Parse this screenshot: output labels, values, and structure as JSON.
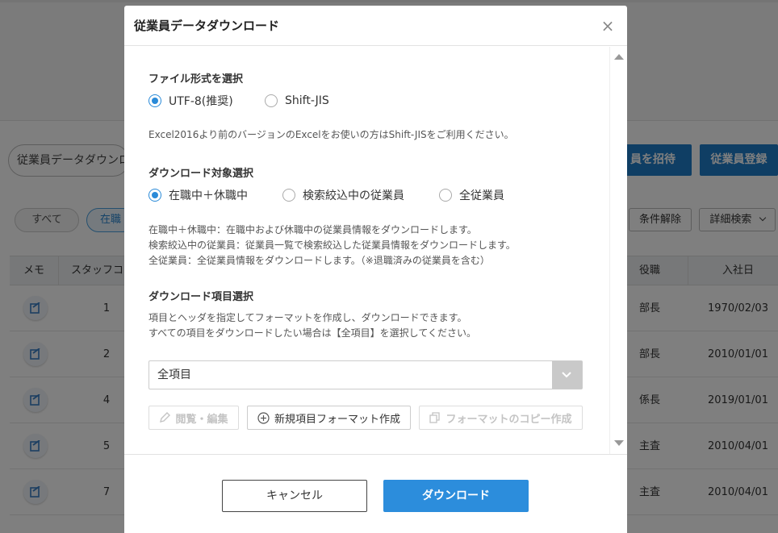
{
  "background": {
    "search_text": "従業員データダウンロ",
    "invite_button": "員を招待",
    "register_button": "従業員登録",
    "filter_all": "すべて",
    "filter_active": "在職",
    "clear_conditions": "条件解除",
    "advanced_search": "詳細検索",
    "table": {
      "headers": {
        "memo": "メモ",
        "staff_code": "スタッフコー",
        "position": "役職",
        "hire_date": "入社日"
      },
      "rows": [
        {
          "code": "1",
          "position": "部長",
          "hire_date": "1970/02/03"
        },
        {
          "code": "2",
          "position": "部長",
          "hire_date": "2010/01/01"
        },
        {
          "code": "4",
          "position": "係長",
          "hire_date": "2019/01/01"
        },
        {
          "code": "5",
          "position": "主査",
          "hire_date": "2010/04/01"
        },
        {
          "code": "7",
          "position": "主査",
          "hire_date": "2010/04/01"
        }
      ]
    }
  },
  "modal": {
    "title": "従業員データダウンロード",
    "close_label": "×",
    "file_format": {
      "title": "ファイル形式を選択",
      "options": [
        "UTF-8(推奨)",
        "Shift-JIS"
      ],
      "selected": "UTF-8(推奨)",
      "note": "Excel2016より前のバージョンのExcelをお使いの方はShift-JISをご利用ください。"
    },
    "target": {
      "title": "ダウンロード対象選択",
      "options": [
        "在職中＋休職中",
        "検索絞込中の従業員",
        "全従業員"
      ],
      "selected": "在職中＋休職中",
      "notes": [
        "在職中＋休職中：在職中および休職中の従業員情報をダウンロードします。",
        "検索絞込中の従業員：従業員一覧で検索絞込した従業員情報をダウンロードします。",
        "全従業員：全従業員情報をダウンロードします。（※退職済みの従業員を含む）"
      ]
    },
    "items": {
      "title": "ダウンロード項目選択",
      "notes": [
        "項目とヘッダを指定してフォーマットを作成し、ダウンロードできます。",
        "すべての項目をダウンロードしたい場合は【全項目】を選択してください。"
      ],
      "select_value": "全項目",
      "view_edit_button": "閲覧・編集",
      "new_format_button": "新規項目フォーマット作成",
      "copy_format_button": "フォーマットのコピー作成"
    },
    "cancel_button": "キャンセル",
    "download_button": "ダウンロード"
  },
  "colors": {
    "primary": "#2c8ddc",
    "overlay": "rgba(0,0,0,0.5)"
  }
}
